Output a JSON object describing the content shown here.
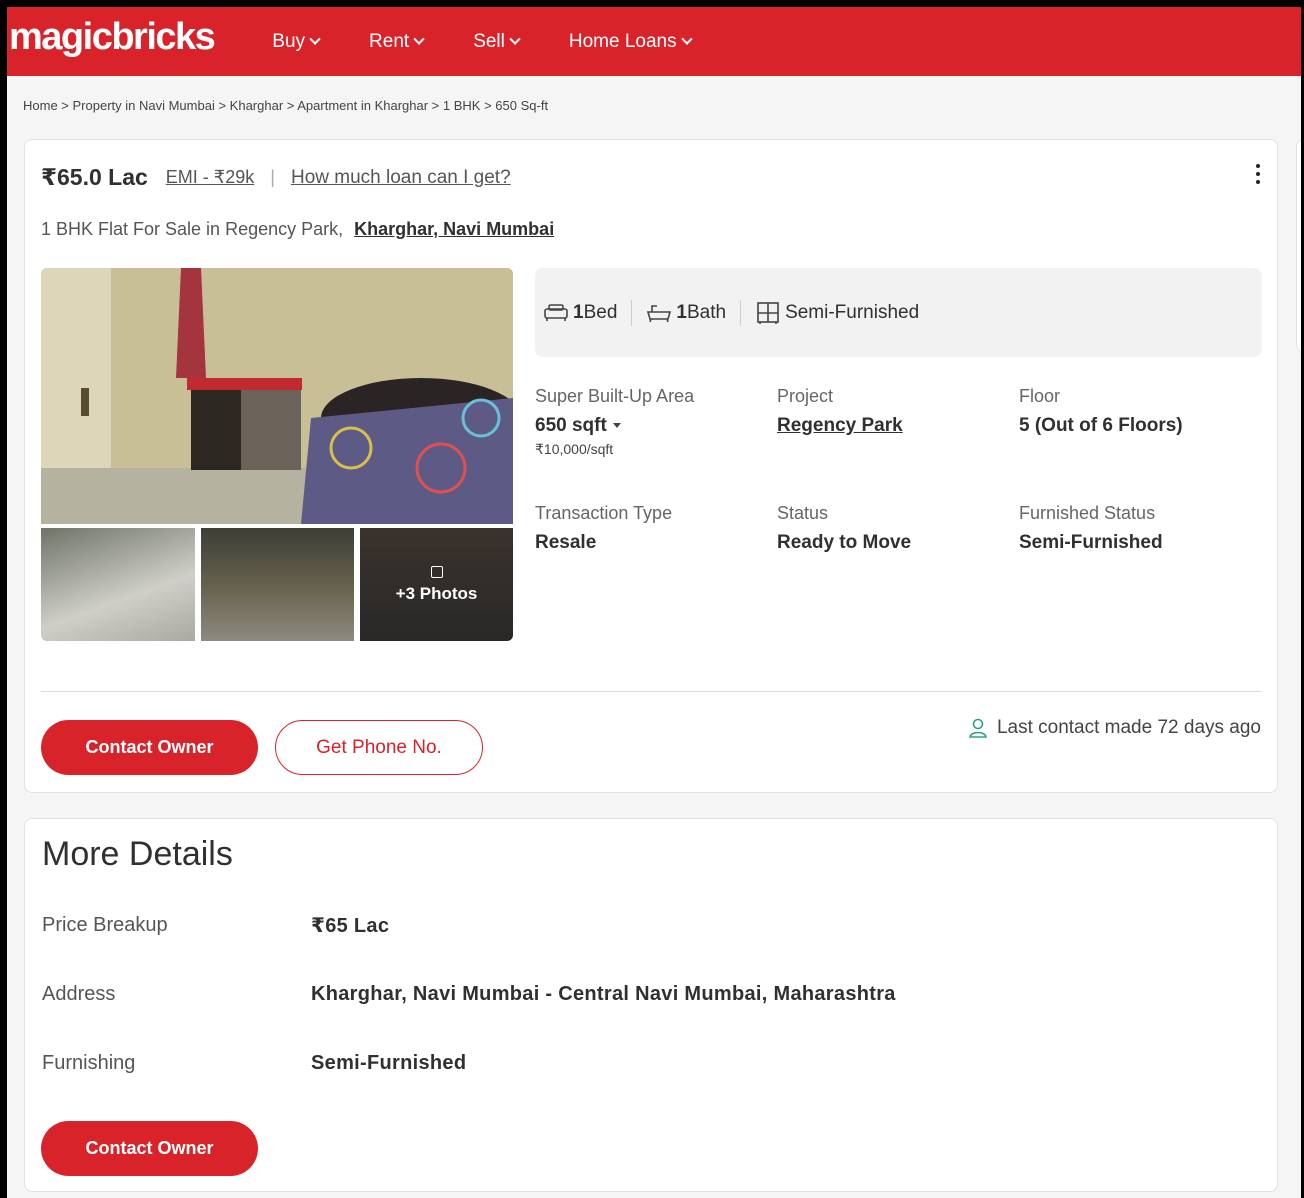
{
  "header": {
    "logo": "magicbricks",
    "nav": [
      {
        "label": "Buy"
      },
      {
        "label": "Rent"
      },
      {
        "label": "Sell"
      },
      {
        "label": "Home Loans"
      }
    ]
  },
  "breadcrumb": [
    "Home",
    "Property in Navi Mumbai",
    "Kharghar",
    "Apartment in Kharghar",
    "1 BHK",
    "650 Sq-ft"
  ],
  "listing": {
    "price": "₹65.0 Lac",
    "emi": "EMI - ₹29k",
    "loan_link": "How much loan can I get?",
    "subtitle": "1 BHK Flat For Sale in Regency Park,",
    "location_link": "Kharghar, Navi Mumbai",
    "photos_more": "+3 Photos",
    "amenities": {
      "bed": "1",
      "bed_label": "Bed",
      "bath": "1",
      "bath_label": "Bath",
      "furnish": "Semi-Furnished"
    },
    "specs": {
      "area_label": "Super Built-Up Area",
      "area_value": "650 sqft",
      "area_rate": "₹10,000/sqft",
      "project_label": "Project",
      "project_value": "Regency Park",
      "floor_label": "Floor",
      "floor_value": "5 (Out of 6 Floors)",
      "transaction_label": "Transaction Type",
      "transaction_value": "Resale",
      "status_label": "Status",
      "status_value": "Ready to Move",
      "furnished_label": "Furnished Status",
      "furnished_value": "Semi-Furnished"
    },
    "contact_button": "Contact Owner",
    "phone_button": "Get Phone No.",
    "last_contact": "Last contact made 72 days ago"
  },
  "more_details": {
    "title": "More Details",
    "rows": [
      {
        "key": "Price Breakup",
        "value": "₹65 Lac"
      },
      {
        "key": "Address",
        "value": "Kharghar, Navi Mumbai - Central Navi Mumbai, Maharashtra"
      },
      {
        "key": "Furnishing",
        "value": "Semi-Furnished"
      }
    ],
    "contact_button": "Contact Owner"
  },
  "colors": {
    "brand": "#d8232a",
    "accent_green": "#2ea37d"
  }
}
